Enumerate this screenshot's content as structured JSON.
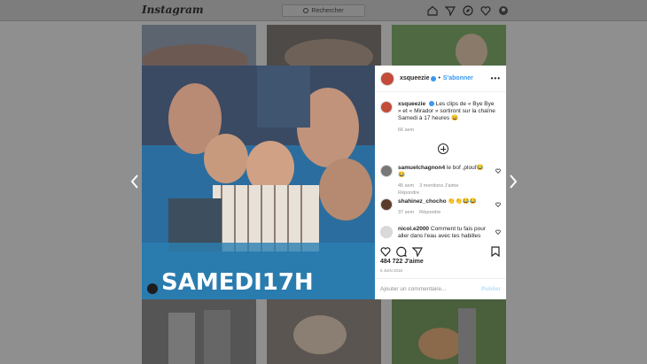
{
  "topbar": {
    "logo": "Instagram",
    "search_placeholder": "Rechercher"
  },
  "post": {
    "overlay_text": "SAMEDI17H",
    "username": "xsqueezie",
    "follow_label": "S'abonner",
    "more_label": "•••",
    "caption": "Les clips de « Bye Bye » et « Mirador » sortiront sur la chaîne Samedi à 17 heures 😄",
    "caption_time": "66 sem",
    "likes": "484 722 J'aime",
    "date": "6 JUIN 2018",
    "add_comment_placeholder": "Ajouter un commentaire...",
    "publish_label": "Publier"
  },
  "comments": [
    {
      "username": "samuelchagnon4",
      "text": "le bof ,plouf😂😂",
      "time": "45 sem",
      "likes": "3 mentions J'aime",
      "reply": "Répondre"
    },
    {
      "username": "shahinez_chocho",
      "text": "👏👏😂😂",
      "time": "37 sem",
      "reply": "Répondre"
    },
    {
      "username": "nicol.e2000",
      "text": "Comment tu fais pour aller dans l'eau avec tes habilles"
    }
  ],
  "colors": {
    "accent": "#3897f0",
    "dim_background": "#8f8f8f"
  },
  "icons": [
    "search-icon",
    "home-icon",
    "direct-icon",
    "explore-icon",
    "heart-icon",
    "profile-icon",
    "chevron-left-icon",
    "chevron-right-icon",
    "add-icon",
    "comment-icon",
    "share-icon",
    "bookmark-icon",
    "user-tag-icon"
  ]
}
